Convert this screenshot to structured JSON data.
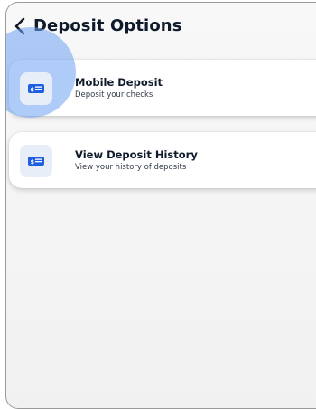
{
  "header": {
    "title": "Deposit Options",
    "back_icon": "chevron-left-icon"
  },
  "options": [
    {
      "title": "Mobile Deposit",
      "subtitle": "Deposit your checks",
      "icon": "check-icon",
      "pressed": true
    },
    {
      "title": "View Deposit History",
      "subtitle": "View your history of deposits",
      "icon": "check-icon",
      "pressed": false
    }
  ],
  "colors": {
    "accent": "#1e5fe0",
    "ripple": "#6ea0f0",
    "icon_bg": "#e8eef7"
  }
}
